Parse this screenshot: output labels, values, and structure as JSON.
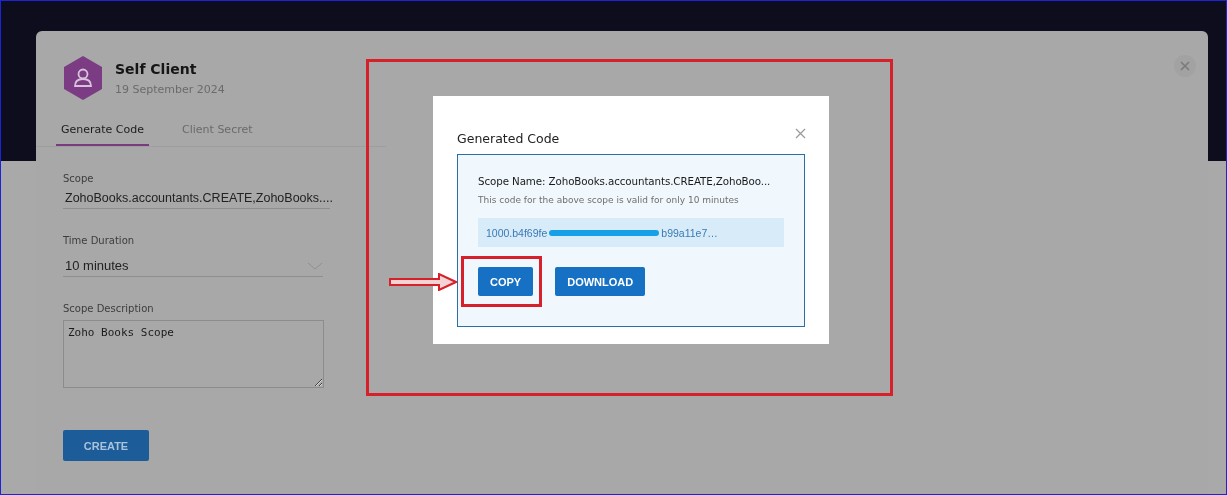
{
  "client": {
    "name": "Self Client",
    "date": "19 September 2024"
  },
  "tabs": [
    {
      "label": "Generate Code",
      "selected": true
    },
    {
      "label": "Client Secret",
      "selected": false
    }
  ],
  "form": {
    "scope": {
      "label": "Scope",
      "value": "ZohoBooks.accountants.CREATE,ZohoBooks...."
    },
    "time_duration": {
      "label": "Time Duration",
      "value": "10 minutes"
    },
    "scope_description": {
      "label": "Scope Description",
      "value": "Zoho Books Scope"
    },
    "submit": "CREATE"
  },
  "dialog": {
    "title": "Generated Code",
    "scope_name": "Scope Name: ZohoBooks.accountants.CREATE,ZohoBoo...",
    "note": "This code for the above scope is valid for only 10 minutes",
    "code_start": "1000.b4f69fe",
    "code_end": "b99a11e7…",
    "buttons": [
      "COPY",
      "DOWNLOAD"
    ]
  }
}
